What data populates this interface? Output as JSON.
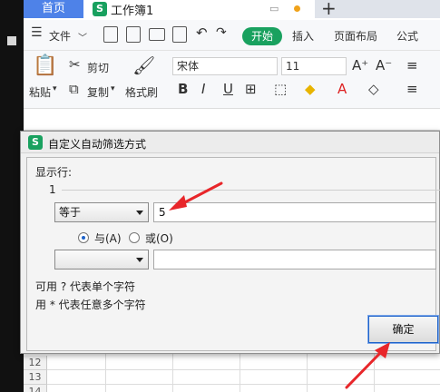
{
  "tabs": {
    "home": "首页",
    "doc": "工作簿1"
  },
  "menu": {
    "file": "文件",
    "start": "开始",
    "insert": "插入",
    "page_layout": "页面布局",
    "formula": "公式"
  },
  "ribbon": {
    "paste": "粘贴",
    "cut": "剪切",
    "copy": "复制",
    "format_painter": "格式刷",
    "font_name": "宋体",
    "font_size": "11"
  },
  "dialog": {
    "title": "自定义自动筛选方式",
    "show_rows": "显示行:",
    "column": "1",
    "cond1_operator": "等于",
    "cond1_value": "5",
    "and_label": "与(A)",
    "or_label": "或(O)",
    "cond2_operator": "",
    "cond2_value": "",
    "hint1": "可用 ? 代表单个字符",
    "hint2": "用 * 代表任意多个字符",
    "ok": "确定"
  },
  "sheet": {
    "rows": [
      "12",
      "13",
      "14"
    ]
  },
  "colors": {
    "accent_green": "#19a15f",
    "tab_blue": "#4e82e8",
    "annotation_red": "#e8262a"
  }
}
